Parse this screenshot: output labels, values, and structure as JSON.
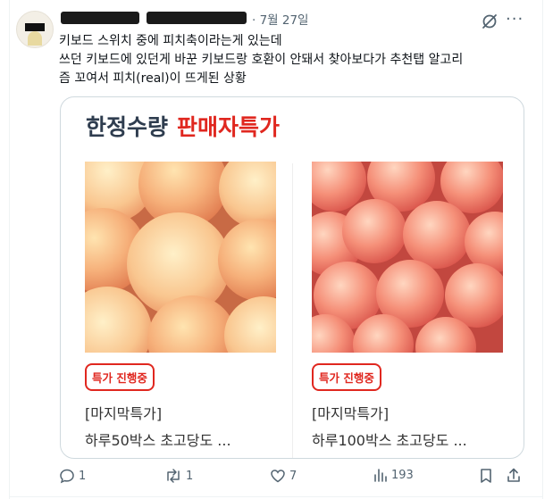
{
  "tweet": {
    "date": "· 7월 27일",
    "lines": [
      "키보드 스위치 중에 피치축이라는게 있는데",
      "쓰던 키보드에 있던게 바꾼 키보드랑 호환이 안돼서 찾아보다가 추천탭 알고리",
      "즘 꼬여서 피치(real)이 뜨게된 상황"
    ]
  },
  "card": {
    "title_dark": "한정수량",
    "title_red": "판매자특가",
    "products": [
      {
        "badge": "특가 진행중",
        "name_line1": "[마지막특가]",
        "name_line2": "하루50박스 초고당도 ..."
      },
      {
        "badge": "특가 진행중",
        "name_line1": "[마지막특가]",
        "name_line2": "하루100박스 초고당도 ..."
      }
    ]
  },
  "actions": {
    "reply_count": "1",
    "retweet_count": "1",
    "like_count": "7",
    "view_count": "193"
  },
  "icons": {
    "reply": "reply-icon",
    "retweet": "retweet-icon",
    "like": "heart-icon",
    "views": "views-icon",
    "bookmark": "bookmark-icon",
    "share": "share-icon",
    "grok": "grok-icon",
    "more": "more-icon"
  },
  "colors": {
    "accent_red": "#e0271f",
    "muted": "#536471",
    "title_dark": "#2f3d4f"
  }
}
